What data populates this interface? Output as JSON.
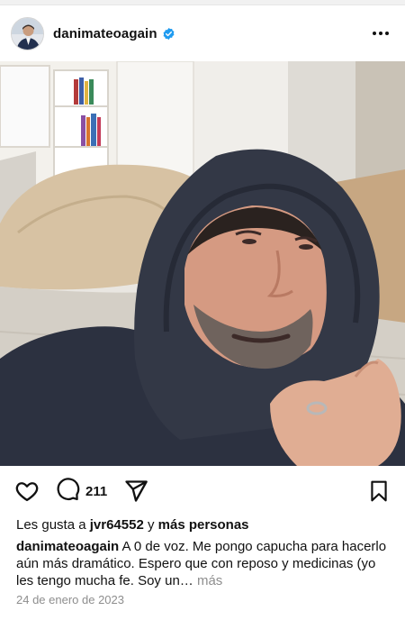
{
  "post": {
    "username": "danimateoagain",
    "verified": true,
    "avatar": {
      "alt": ""
    },
    "photo": {
      "alt": ""
    }
  },
  "actions": {
    "comment_count": "211"
  },
  "likes": {
    "prefix": "Les gusta a",
    "user": "jvr64552",
    "connector": "y",
    "others": "más personas"
  },
  "caption": {
    "username": "danimateoagain",
    "text": "A 0 de voz. Me pongo capucha para hacerlo aún más dramático. Espero que con reposo y medicinas (yo les tengo mucha fe. Soy un…",
    "more_label": "más"
  },
  "date": "24 de enero de 2023",
  "colors": {
    "verified_blue": "#1f9bf0",
    "secondary_text": "#8e8e8e",
    "hoodie": "#2c3140"
  }
}
